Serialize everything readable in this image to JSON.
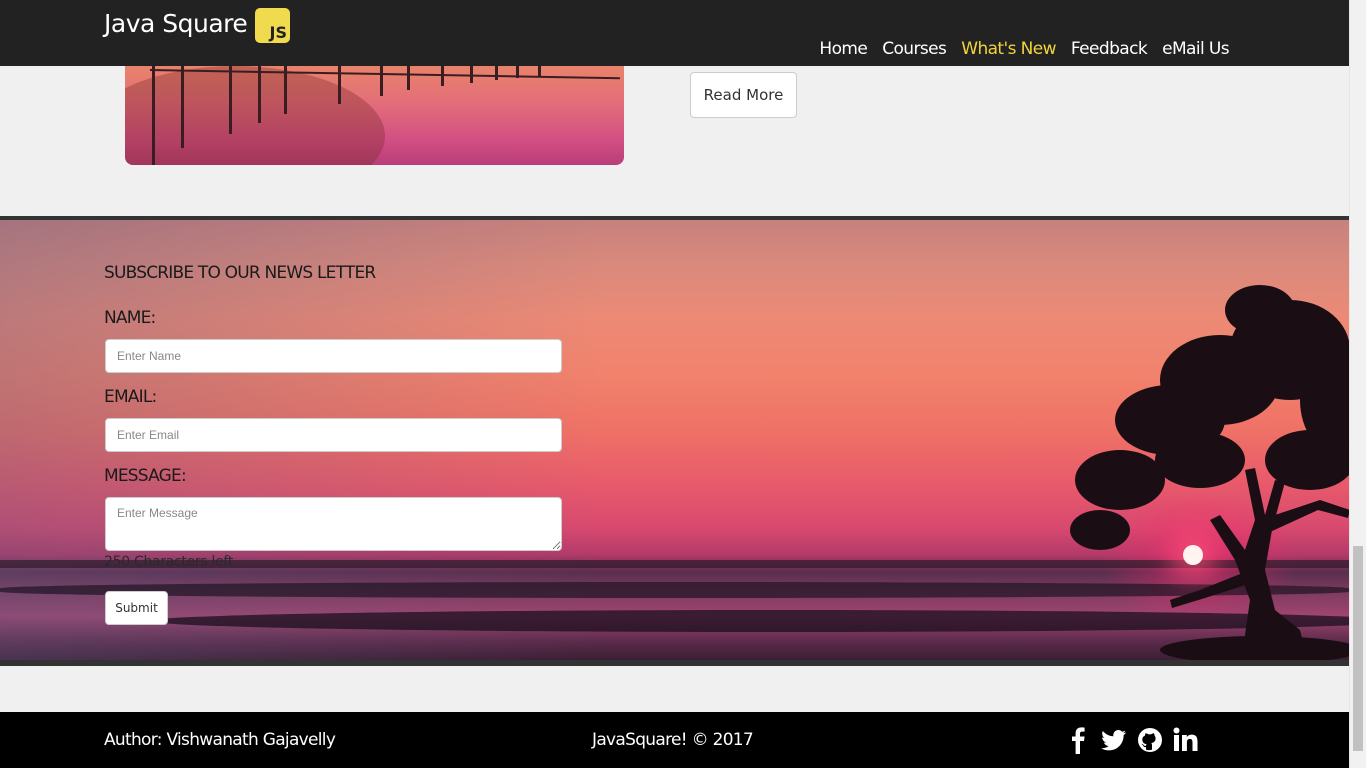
{
  "navbar": {
    "brand": "Java Square",
    "logo_text": "JS",
    "links": [
      {
        "label": "Home",
        "active": false
      },
      {
        "label": "Courses",
        "active": false
      },
      {
        "label": "What's New",
        "active": true
      },
      {
        "label": "Feedback",
        "active": false
      },
      {
        "label": "eMail Us",
        "active": false
      }
    ]
  },
  "article": {
    "read_more_label": "Read More"
  },
  "newsletter": {
    "title": "SUBSCRIBE TO OUR NEWS LETTER",
    "name_label": "NAME:",
    "name_placeholder": "Enter Name",
    "email_label": "EMAIL:",
    "email_placeholder": "Enter Email",
    "message_label": "MESSAGE:",
    "message_placeholder": "Enter Message",
    "chars_left": "250 Characters left",
    "submit_label": "Submit"
  },
  "footer": {
    "author": "Author: Vishwanath Gajavelly",
    "copyright": "JavaSquare! © 2017",
    "social_icons": [
      "facebook-icon",
      "twitter-icon",
      "github-icon",
      "linkedin-icon"
    ]
  },
  "colors": {
    "navbar_bg": "#222222",
    "active_link": "#f0d43a",
    "js_logo": "#f0db4f",
    "footer_bg": "#000000"
  }
}
